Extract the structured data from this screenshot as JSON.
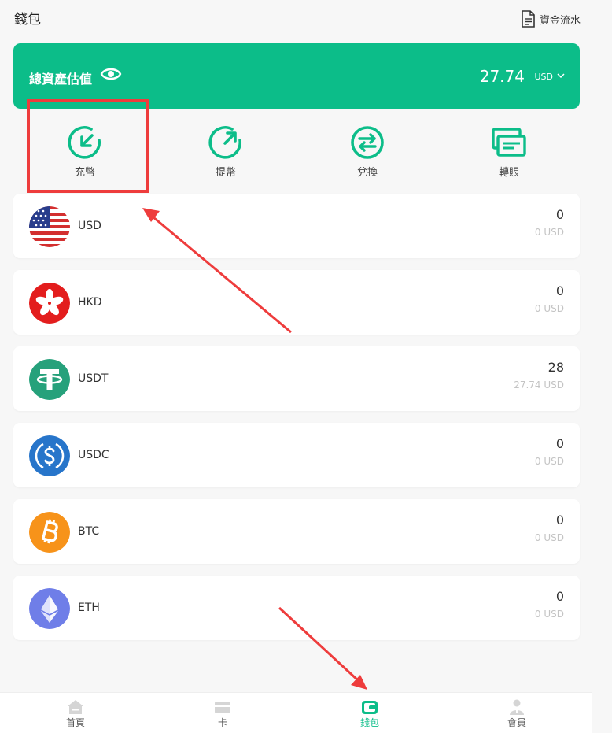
{
  "header": {
    "title": "錢包",
    "flow_label": "資金流水"
  },
  "asset": {
    "label": "總資產估值",
    "amount": "27.74",
    "currency": "USD"
  },
  "actions": [
    {
      "label": "充幣"
    },
    {
      "label": "提幣"
    },
    {
      "label": "兌換"
    },
    {
      "label": "轉賬"
    }
  ],
  "coins": [
    {
      "name": "USD",
      "amount": "0",
      "usd": "0 USD"
    },
    {
      "name": "HKD",
      "amount": "0",
      "usd": "0 USD"
    },
    {
      "name": "USDT",
      "amount": "28",
      "usd": "27.74 USD"
    },
    {
      "name": "USDC",
      "amount": "0",
      "usd": "0 USD"
    },
    {
      "name": "BTC",
      "amount": "0",
      "usd": "0 USD"
    },
    {
      "name": "ETH",
      "amount": "0",
      "usd": "0 USD"
    }
  ],
  "tabs": [
    {
      "label": "首頁"
    },
    {
      "label": "卡"
    },
    {
      "label": "錢包"
    },
    {
      "label": "會員"
    }
  ],
  "colors": {
    "accent": "#0cbd89",
    "annotation": "#ee3c3c"
  }
}
